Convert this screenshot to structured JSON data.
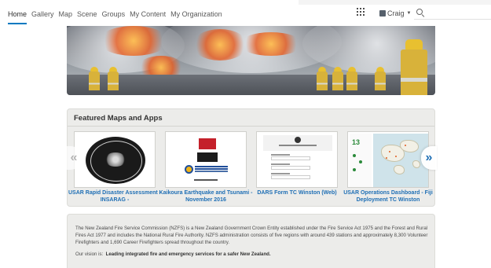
{
  "nav": {
    "links": [
      "Home",
      "Gallery",
      "Map",
      "Scene",
      "Groups",
      "My Content",
      "My Organization"
    ],
    "active": "Home",
    "user_name": "Craig",
    "search_placeholder": ""
  },
  "featured": {
    "title": "Featured Maps and Apps",
    "items": [
      {
        "caption": "USAR Rapid Disaster Assessment - INSARAG -"
      },
      {
        "caption": "Kaikoura Earthquake and Tsunami - November 2016"
      },
      {
        "caption": "DARS Form TC Winston (Web)",
        "thumb_title": "DARS Web Form - TC Winston"
      },
      {
        "caption": "USAR Operations Dashboard - Fiji Deployment TC Winston",
        "thumb_number": "13"
      }
    ],
    "logo_text": {
      "fire": "FIRE",
      "defence": "DEFENCE FORCE",
      "civil": "Ministry of Civil Defence & Emergency Management"
    }
  },
  "about": {
    "text": "The New Zealand Fire Service Commission (NZFS) is a New Zealand Government Crown Entity established under the Fire Service Act 1975 and the Forest and Rural Fires Act 1977 and includes the National Rural Fire Authority.  NZFS administration consists of five regions with around 439 stations and approximately  8,300 Volunteer Firefighters and 1,690 Career Firefighters spread throughout the country.",
    "vision_label": "Our vision is:",
    "vision": "Leading integrated fire and emergency services for a safer New Zealand."
  },
  "colors": {
    "accent": "#0079c1",
    "link": "#1f6fb5"
  }
}
